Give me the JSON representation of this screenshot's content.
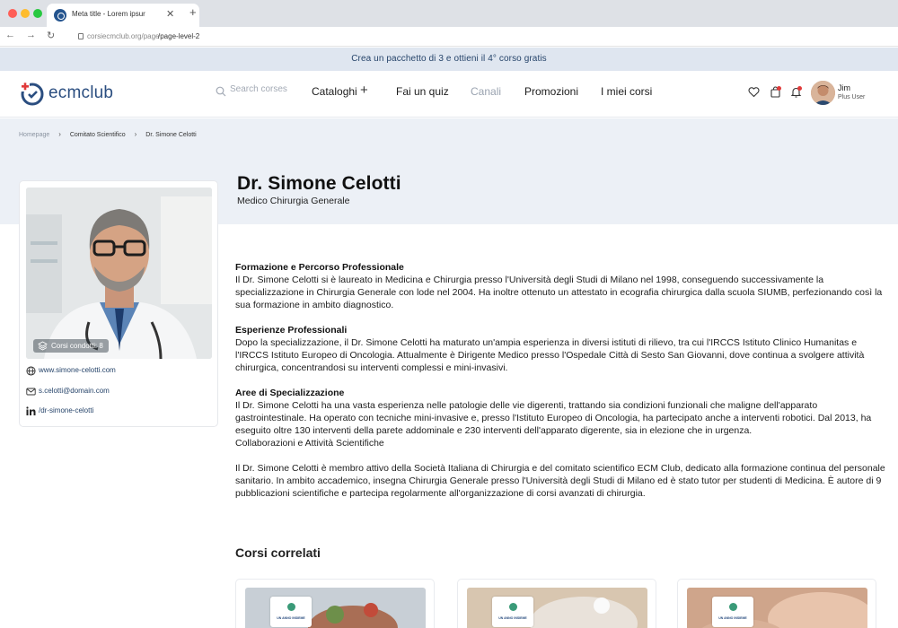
{
  "browser": {
    "tab_title": "Meta title - Lorem ipsur",
    "url_host": "corsiecmclub.org/page",
    "url_path": "/page-level-2"
  },
  "promo": {
    "text": "Crea un pacchetto di 3 e ottieni il 4° corso gratis"
  },
  "header": {
    "logo_text": "ecmclub",
    "search_placeholder": "Search corses",
    "nav": {
      "cataloghi": "Cataloghi",
      "quiz": "Fai un quiz",
      "canali": "Canali",
      "promozioni": "Promozioni",
      "corsi": "I miei corsi"
    },
    "user": {
      "name": "Jim",
      "plan": "Plus User"
    },
    "colors": {
      "brand": "#2b4e80",
      "accent": "#e03a3a"
    }
  },
  "breadcrumb": {
    "home": "Homepage",
    "section": "Comitato Scientifico",
    "current": "Dr. Simone Celotti"
  },
  "profile": {
    "name": "Dr. Simone Celotti",
    "role": "Medico Chirurgia Generale",
    "courses_badge": "Corsi condotti: 8",
    "website": "www.simone-celotti.com",
    "email": "s.celotti@domain.com",
    "linkedin": "/dr-simone-celotti"
  },
  "bio": {
    "s1_title": "Formazione e Percorso Professionale",
    "s1_text": "Il Dr. Simone Celotti si è laureato in Medicina e Chirurgia presso l'Università degli Studi di Milano nel 1998, conseguendo successivamente la specializzazione in Chirurgia Generale con lode nel 2004. Ha inoltre ottenuto un attestato in ecografia chirurgica dalla scuola SIUMB, perfezionando così la sua formazione in ambito diagnostico.",
    "s2_title": "Esperienze Professionali",
    "s2_text": "Dopo la specializzazione, il Dr. Simone Celotti ha maturato un'ampia esperienza in diversi istituti di rilievo, tra cui l'IRCCS Istituto Clinico Humanitas e l'IRCCS Istituto Europeo di Oncologia. Attualmente è Dirigente Medico presso l'Ospedale Città di Sesto San Giovanni, dove continua a svolgere attività chirurgica, concentrandosi su interventi complessi e mini-invasivi.",
    "s3_title": "Aree di Specializzazione",
    "s3_text": "Il Dr. Simone Celotti ha una vasta esperienza nelle patologie delle vie digerenti, trattando sia condizioni funzionali che maligne dell'apparato gastrointestinale. Ha operato con tecniche mini-invasive e, presso l'Istituto Europeo di Oncologia, ha partecipato anche a interventi robotici. Dal 2013, ha eseguito oltre 130 interventi della parete addominale e 230 interventi dell'apparato digerente, sia in elezione che in urgenza.",
    "s3_extra": "Collaborazioni e Attività Scientifiche",
    "s4_text": "Il Dr. Simone Celotti è membro attivo della Società Italiana di Chirurgia e del comitato scientifico ECM Club, dedicato alla formazione continua del personale sanitario. In ambito accademico, insegna Chirurgia Generale presso l'Università degli Studi di Milano ed è stato tutor per studenti di Medicina. È autore di 9 pubblicazioni scientifiche e partecipa regolarmente all'organizzazione di corsi avanzati di chirurgia."
  },
  "related": {
    "title": "Corsi correlati",
    "card_logo": "UN ANNO INSIEME"
  }
}
